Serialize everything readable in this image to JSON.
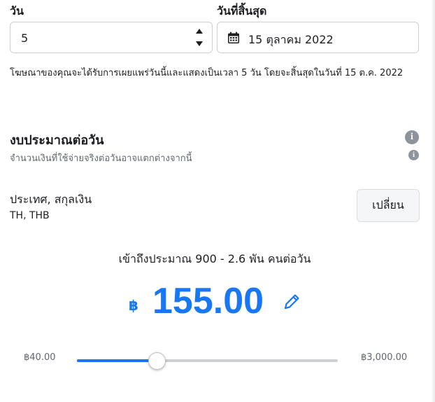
{
  "schedule": {
    "days_label": "วัน",
    "days_value": "5",
    "end_date_label": "วันที่สิ้นสุด",
    "end_date_value": "15 ตุลาคม  2022",
    "info": "โฆษณาของคุณจะได้รับการเผยแพร่วันนี้และแสดงเป็นเวลา 5 วัน โดยจะสิ้นสุดในวันที่ 15 ต.ค. 2022"
  },
  "budget": {
    "title": "งบประมาณต่อวัน",
    "subtitle": "จำนวนเงินที่ใช้จ่ายจริงต่อวันอาจแตกต่างจากนี้",
    "country_label": "ประเทศ, สกุลเงิน",
    "country_value": "TH, THB",
    "change_button": "เปลี่ยน",
    "reach": "เข้าถึงประมาณ 900 - 2.6 พัน คนต่อวัน",
    "currency_symbol": "฿",
    "amount": "155.00",
    "slider_min_label": "฿40.00",
    "slider_max_label": "฿3,000.00",
    "slider_fraction": 0.308,
    "accent_color": "#1877f2"
  },
  "icons": [
    "stepper-icon",
    "calendar-icon",
    "info-icon",
    "pencil-icon"
  ]
}
